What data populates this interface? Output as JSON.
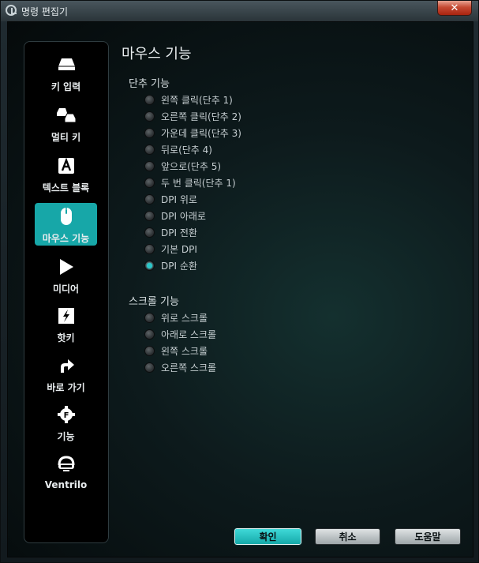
{
  "window": {
    "title": "명령 편집기",
    "close_label": "✕"
  },
  "sidebar": {
    "items": [
      {
        "label": "키 입력",
        "icon": "key-icon",
        "active": false
      },
      {
        "label": "멀티 키",
        "icon": "multikey-icon",
        "active": false
      },
      {
        "label": "텍스트 블록",
        "icon": "text-block-icon",
        "active": false
      },
      {
        "label": "마우스 기능",
        "icon": "mouse-icon",
        "active": true
      },
      {
        "label": "미디어",
        "icon": "play-icon",
        "active": false
      },
      {
        "label": "핫키",
        "icon": "hotkey-icon",
        "active": false
      },
      {
        "label": "바로 가기",
        "icon": "shortcut-arrow-icon",
        "active": false
      },
      {
        "label": "기능",
        "icon": "function-gear-icon",
        "active": false
      },
      {
        "label": "Ventrilo",
        "icon": "headset-icon",
        "active": false
      }
    ]
  },
  "main": {
    "title": "마우스 기능",
    "single_group": {
      "title": "단추 기능",
      "options": [
        {
          "label": "왼쪽 클릭(단추 1)",
          "checked": false
        },
        {
          "label": "오른쪽 클릭(단추 2)",
          "checked": false
        },
        {
          "label": "가운데 클릭(단추 3)",
          "checked": false
        },
        {
          "label": "뒤로(단추 4)",
          "checked": false
        },
        {
          "label": "앞으로(단추 5)",
          "checked": false
        },
        {
          "label": "두 번 클릭(단추 1)",
          "checked": false
        },
        {
          "label": "DPI 위로",
          "checked": false
        },
        {
          "label": "DPI 아래로",
          "checked": false
        },
        {
          "label": "DPI 전환",
          "checked": false
        },
        {
          "label": "기본 DPI",
          "checked": false
        },
        {
          "label": "DPI 순환",
          "checked": true
        }
      ]
    },
    "scroll_group": {
      "title": "스크롤 기능",
      "options": [
        {
          "label": "위로 스크롤",
          "checked": false
        },
        {
          "label": "아래로 스크롤",
          "checked": false
        },
        {
          "label": "왼쪽 스크롤",
          "checked": false
        },
        {
          "label": "오른쪽 스크롤",
          "checked": false
        }
      ]
    }
  },
  "buttons": {
    "ok": "확인",
    "cancel": "취소",
    "help": "도움말"
  },
  "colors": {
    "accent": "#17a7a8",
    "background": "#0d1a1c"
  }
}
